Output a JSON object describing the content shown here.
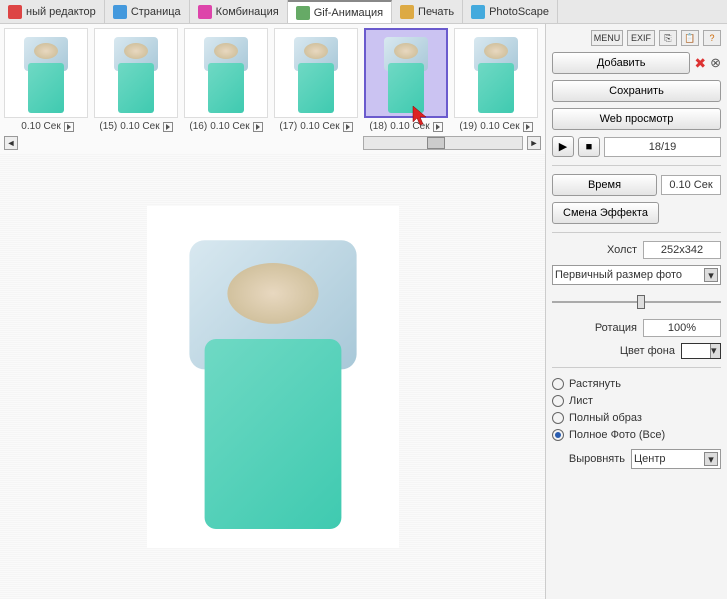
{
  "tabs": [
    {
      "label": "ный редактор",
      "icon": "editor-icon",
      "color": "#d44"
    },
    {
      "label": "Страница",
      "icon": "page-icon",
      "color": "#49d"
    },
    {
      "label": "Комбинация",
      "icon": "combination-icon",
      "color": "#d4a"
    },
    {
      "label": "Gif-Анимация",
      "icon": "gif-icon",
      "color": "#6a6",
      "active": true
    },
    {
      "label": "Печать",
      "icon": "print-icon",
      "color": "#da4"
    },
    {
      "label": "PhotoScape",
      "icon": "photoscape-icon",
      "color": "#4ad"
    }
  ],
  "iconbar": {
    "menu": "MENU",
    "exif": "EXIF"
  },
  "buttons": {
    "add": "Добавить",
    "save": "Сохранить",
    "webview": "Web просмотр",
    "time": "Время",
    "effect": "Смена Эффекта"
  },
  "playback": {
    "frame": "18/19"
  },
  "time_value": "0.10 Сек",
  "canvas_label": "Холст",
  "canvas_size": "252x342",
  "resize_mode": "Первичный размер фото",
  "rotation_label": "Ротация",
  "rotation_value": "100%",
  "bgcolor_label": "Цвет фона",
  "fit_options": [
    "Растянуть",
    "Лист",
    "Полный образ",
    "Полное Фото (Все)"
  ],
  "fit_selected": 3,
  "align_label": "Выровнять",
  "align_value": "Центр",
  "thumbs": [
    {
      "n": "",
      "sec": "0.10 Сек"
    },
    {
      "n": "(15)",
      "sec": "0.10 Сек"
    },
    {
      "n": "(16)",
      "sec": "0.10 Сек"
    },
    {
      "n": "(17)",
      "sec": "0.10 Сек"
    },
    {
      "n": "(18)",
      "sec": "0.10 Сек",
      "selected": true
    },
    {
      "n": "(19)",
      "sec": "0.10 Сек"
    }
  ]
}
